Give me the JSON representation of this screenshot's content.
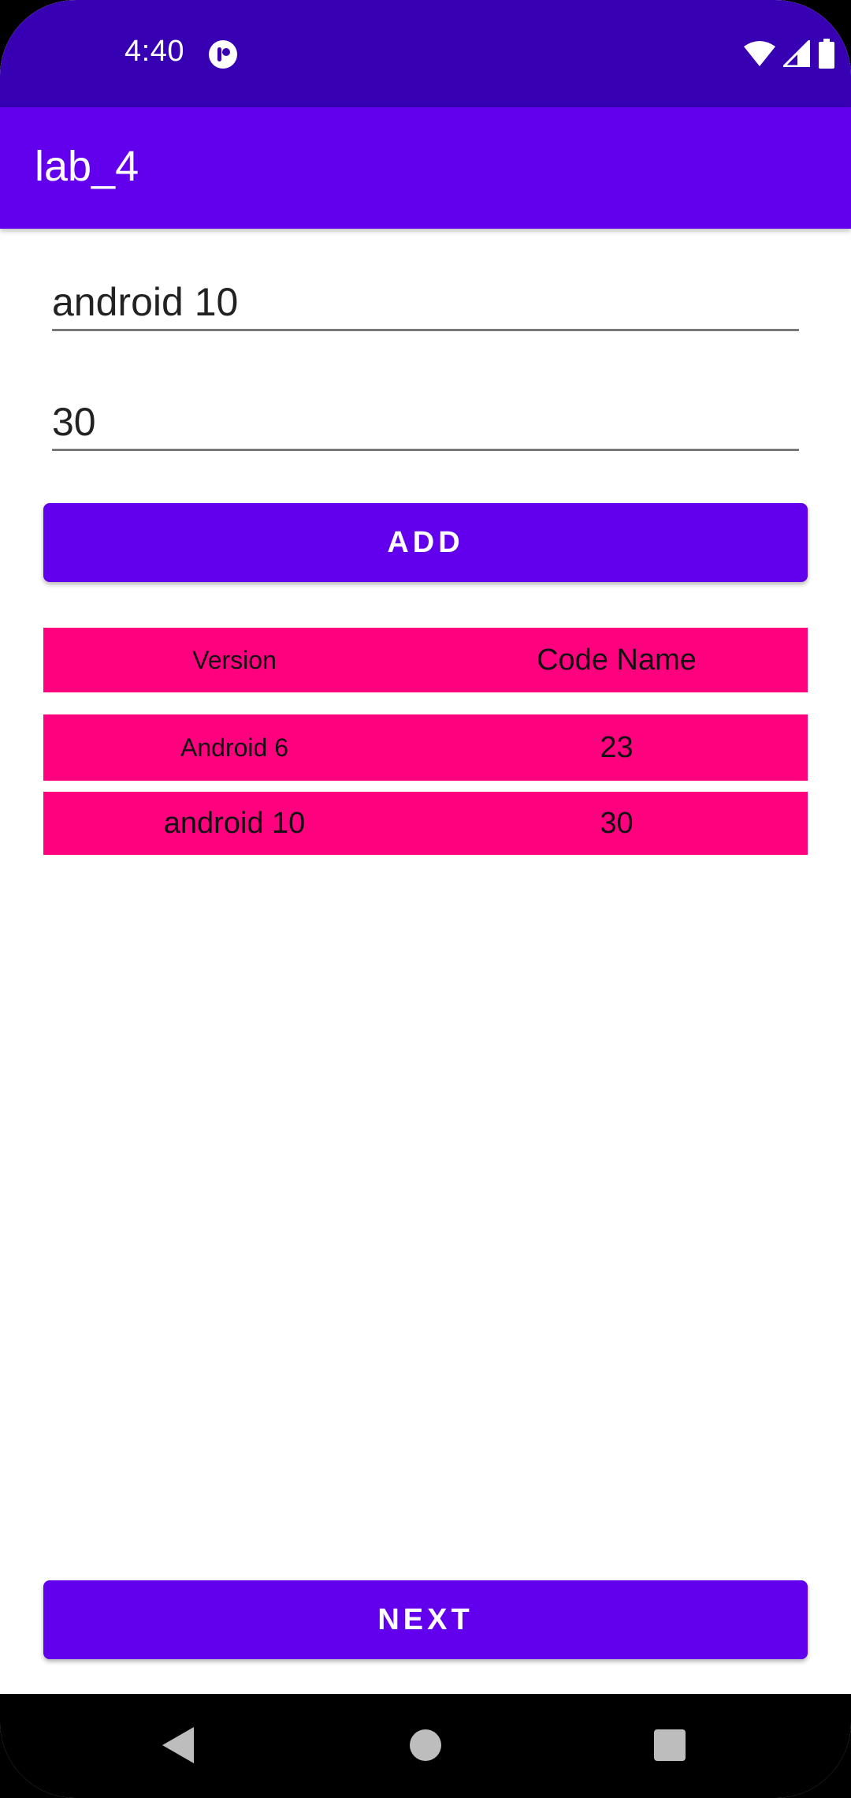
{
  "status_bar": {
    "time": "4:40",
    "icons": [
      "notification-icon",
      "wifi-icon",
      "signal-icon",
      "battery-icon"
    ]
  },
  "app_bar": {
    "title": "lab_4"
  },
  "form": {
    "version_input": {
      "value": "android 10",
      "placeholder": ""
    },
    "code_input": {
      "value": "30",
      "placeholder": ""
    },
    "add_label": "ADD"
  },
  "table": {
    "headers": {
      "version": "Version",
      "code_name": "Code Name"
    },
    "rows": [
      {
        "version": "Android 6",
        "code": "23"
      },
      {
        "version": "android 10",
        "code": "30"
      }
    ]
  },
  "next_label": "NEXT",
  "colors": {
    "status_bar": "#3700B3",
    "primary": "#6200EE",
    "row_background": "#FF007F"
  }
}
